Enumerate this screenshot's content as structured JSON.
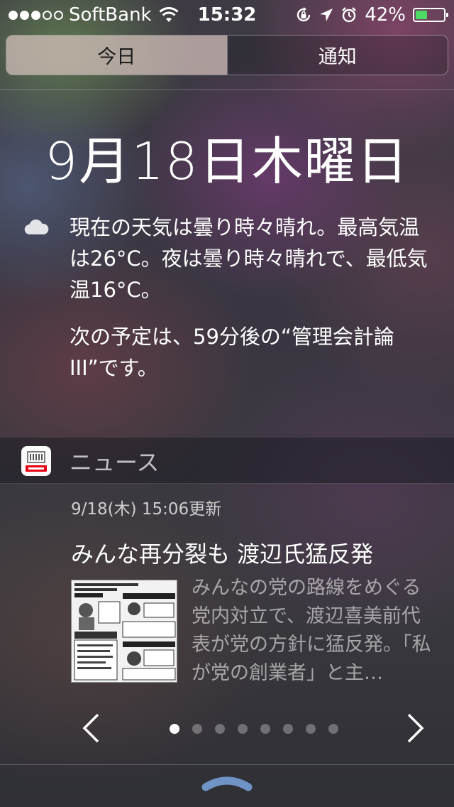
{
  "status_bar": {
    "signal_full": 3,
    "signal_total": 5,
    "carrier": "SoftBank",
    "time": "15:32",
    "battery_percent": "42%",
    "battery_level": 0.42,
    "icons": [
      "wifi-icon",
      "orientation-lock-icon",
      "location-icon",
      "alarm-icon",
      "battery-icon"
    ]
  },
  "tabs": {
    "today": "今日",
    "notifications": "通知",
    "selected": "today"
  },
  "today": {
    "date": "9月18日木曜日",
    "weather_icon": "cloud-icon",
    "weather_text": "現在の天気は曇り時々晴れ。最高気温は26°C。夜は曇り時々晴れで、最低気温16°C。",
    "schedule_text": "次の予定は、59分後の“管理会計論III”です。"
  },
  "news": {
    "section_title": "ニュース",
    "logo": "yahoo-news-icon",
    "updated": "9/18(木) 15:06更新",
    "headline": "みんな再分裂も 渡辺氏猛反発",
    "summary": "みんなの党の路線をめぐる党内対立で、渡辺喜美前代表が党の方針に猛反発。「私が党の創業者」と主…",
    "page_count": 8,
    "current_page": 1
  },
  "colors": {
    "battery": "#4cd964",
    "segment_selected": "#d7c3be"
  }
}
